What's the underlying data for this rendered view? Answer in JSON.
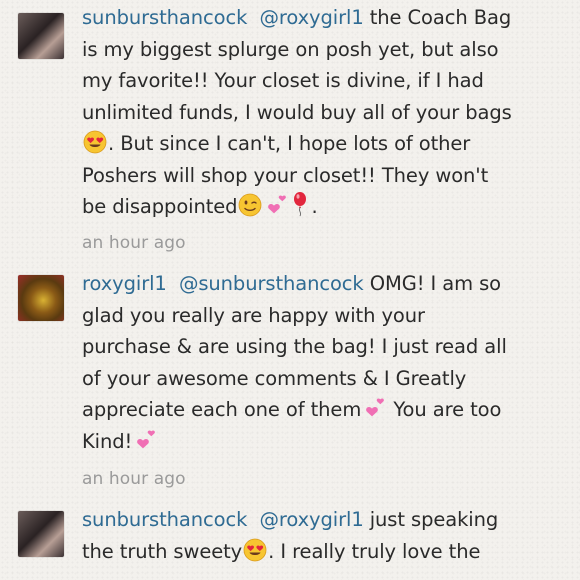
{
  "comments": [
    {
      "username": "sunbursthancock",
      "lines": [
        {
          "mention": "@roxygirl1",
          "text": " the Coach Bag"
        },
        {
          "text": "is my biggest splurge on posh yet, but also"
        },
        {
          "text": "my favorite!!  Your closet is divine, if I had"
        },
        {
          "text": "unlimited funds, I would buy all of your bags"
        },
        {
          "text": ".  But since I can't, I hope lots of other"
        },
        {
          "text": "Poshers will shop your closet!!  They won't"
        },
        {
          "text": "be disappointed"
        },
        {
          "text": "."
        }
      ],
      "emojis": [
        "heart-eyes",
        "wink",
        "two-hearts",
        "balloon"
      ],
      "time": "an hour ago"
    },
    {
      "username": "roxygirl1",
      "lines": [
        {
          "mention": "@sunbursthancock",
          "text": " OMG! I am so"
        },
        {
          "text": "glad you really are happy with your"
        },
        {
          "text": "purchase & are using the bag! I just read all"
        },
        {
          "text": "of your awesome comments & I Greatly"
        },
        {
          "text": "appreciate each one of them"
        },
        {
          "text": " You are too"
        },
        {
          "text": "Kind!"
        }
      ],
      "emojis": [
        "two-hearts",
        "two-hearts"
      ],
      "time": "an hour ago"
    },
    {
      "username": "sunbursthancock",
      "lines": [
        {
          "mention": "@roxygirl1",
          "text": " just speaking"
        },
        {
          "text": "the truth sweety"
        },
        {
          "text": ".  I really truly love the"
        }
      ],
      "emojis": [
        "heart-eyes"
      ]
    }
  ]
}
